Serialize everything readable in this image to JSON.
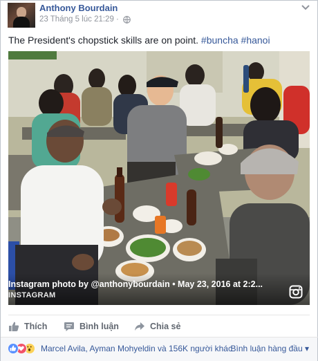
{
  "post": {
    "author": "Anthony Bourdain",
    "timestamp": "23 Tháng 5 lúc 21:29 ·",
    "text_prefix": "The President's chopstick skills are on point. ",
    "hashtags": [
      "#buncha",
      "#hanoi"
    ]
  },
  "photo": {
    "caption": "Instagram photo by @anthonybourdain • May 23, 2016 at 2:2...",
    "source_label": "INSTAGRAM"
  },
  "actions": {
    "like_label": "Thích",
    "comment_label": "Bình luận",
    "share_label": "Chia sẻ"
  },
  "reactions": {
    "summary": "Marcel Avila, Ayman Mohyeldin và 156K người khác",
    "sort_label": "Bình luận hàng đầu ▾",
    "icons": [
      "like-icon",
      "love-icon",
      "wow-icon"
    ]
  },
  "colors": {
    "link": "#365899",
    "muted": "#90949c",
    "action_text": "#616770"
  }
}
